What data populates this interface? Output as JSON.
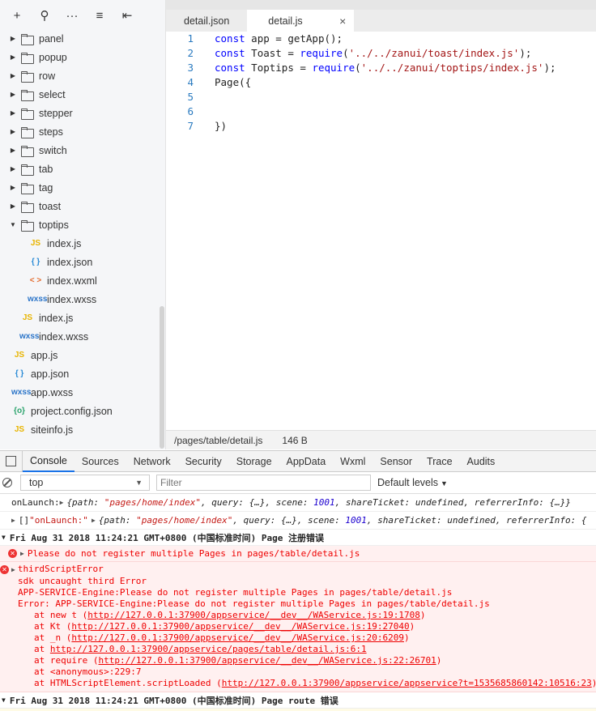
{
  "sidebar": {
    "toolbar": {
      "add": "+",
      "search": "⚲",
      "more": "···",
      "sort": "≡",
      "collapse": "⇤"
    },
    "folders": [
      {
        "label": "panel"
      },
      {
        "label": "popup"
      },
      {
        "label": "row"
      },
      {
        "label": "select"
      },
      {
        "label": "stepper"
      },
      {
        "label": "steps"
      },
      {
        "label": "switch"
      },
      {
        "label": "tab"
      },
      {
        "label": "tag"
      },
      {
        "label": "toast"
      }
    ],
    "open_folder": {
      "label": "toptips"
    },
    "open_folder_files": [
      {
        "label": "index.js",
        "icon": "JS"
      },
      {
        "label": "index.json",
        "icon": "{ }"
      },
      {
        "label": "index.wxml",
        "icon": "< >"
      },
      {
        "label": "index.wxss",
        "icon": "wxss"
      }
    ],
    "parent_files": [
      {
        "label": "index.js",
        "icon": "JS"
      },
      {
        "label": "index.wxss",
        "icon": "wxss"
      }
    ],
    "root_files": [
      {
        "label": "app.js",
        "icon": "JS"
      },
      {
        "label": "app.json",
        "icon": "{ }"
      },
      {
        "label": "app.wxss",
        "icon": "wxss"
      },
      {
        "label": "project.config.json",
        "icon": "{o}"
      },
      {
        "label": "siteinfo.js",
        "icon": "JS"
      }
    ]
  },
  "editor": {
    "tabs": [
      {
        "label": "detail.json"
      },
      {
        "label": "detail.js",
        "close": "×"
      }
    ],
    "line_numbers": [
      "1",
      "2",
      "3",
      "4",
      "5",
      "6",
      "7"
    ],
    "lines": {
      "l1": {
        "kw": "const",
        "rest": " app = getApp();"
      },
      "l2": {
        "kw": "const",
        "mid": " Toast = ",
        "fn": "require",
        "p1": "(",
        "str": "'../../zanui/toast/index.js'",
        "end": ");"
      },
      "l3": {
        "kw": "const",
        "mid": " Toptips = ",
        "fn": "require",
        "p1": "(",
        "str": "'../../zanui/toptips/index.js'",
        "end": ");"
      },
      "l4": "Page({",
      "l5": "",
      "l6": "",
      "l7": "})"
    }
  },
  "statusbar": {
    "path": "/pages/table/detail.js",
    "size": "146 B"
  },
  "devtools": {
    "tabs": [
      "Console",
      "Sources",
      "Network",
      "Security",
      "Storage",
      "AppData",
      "Wxml",
      "Sensor",
      "Trace",
      "Audits"
    ],
    "context": "top",
    "filter_placeholder": "Filter",
    "levels": "Default levels"
  },
  "console": {
    "row1": {
      "prefix": "onLaunch: ",
      "obj": "{path: ",
      "path": "\"pages/home/index\"",
      "q": ", query: {…}, scene: ",
      "scene": "1001",
      "tail": ", shareTicket: undefined, referrerInfo: {…}}"
    },
    "row2": {
      "prefix": "[] ",
      "label": "\"onLaunch:\"",
      "obj": " {path: ",
      "path": "\"pages/home/index\"",
      "q": ", query: {…}, scene: ",
      "scene": "1001",
      "tail": ", shareTicket: undefined, referrerInfo: {"
    },
    "group1": "Fri Aug 31 2018 11:24:21 GMT+0800 (中国标准时间) Page 注册错误",
    "error1": "Please do not register multiple Pages in pages/table/detail.js",
    "error2": {
      "title": "thirdScriptError",
      "l1": "sdk uncaught third Error",
      "l2": "APP-SERVICE-Engine:Please do not register multiple Pages in pages/table/detail.js",
      "l3": "Error: APP-SERVICE-Engine:Please do not register multiple Pages in pages/table/detail.js",
      "stack": [
        {
          "pre": "at new t (",
          "link": "http://127.0.0.1:37900/appservice/__dev__/WAService.js:19:1708",
          "post": ")"
        },
        {
          "pre": "at Kt (",
          "link": "http://127.0.0.1:37900/appservice/__dev__/WAService.js:19:27040",
          "post": ")"
        },
        {
          "pre": "at _n (",
          "link": "http://127.0.0.1:37900/appservice/__dev__/WAService.js:20:6209",
          "post": ")"
        },
        {
          "pre": "at ",
          "link": "http://127.0.0.1:37900/appservice/pages/table/detail.js:6:1",
          "post": ""
        },
        {
          "pre": "at require (",
          "link": "http://127.0.0.1:37900/appservice/__dev__/WAService.js:22:26701",
          "post": ")"
        },
        {
          "pre": "at <anonymous>:229:7",
          "link": "",
          "post": ""
        },
        {
          "pre": "at HTMLScriptElement.scriptLoaded (",
          "link": "http://127.0.0.1:37900/appservice/appservice?t=1535685860142:10516:23",
          "post": ")"
        }
      ]
    },
    "group2": "Fri Aug 31 2018 11:24:21 GMT+0800 (中国标准时间) Page route 错误"
  }
}
